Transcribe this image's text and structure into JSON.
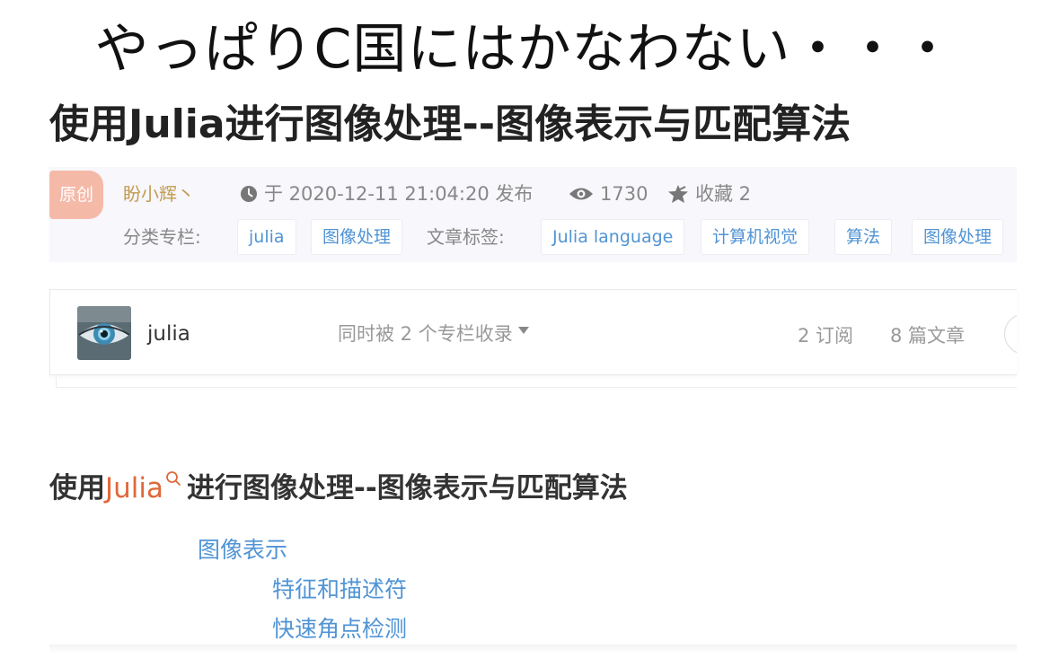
{
  "caption": "やっぱりC国にはかなわない・・・",
  "article": {
    "title": "使用Julia进行图像处理--图像表示与匹配算法",
    "original_badge": "原创",
    "author": "盼小辉丶",
    "published": "于 2020-12-11 21:04:20 发布",
    "views": "1730",
    "favorites": "收藏 2",
    "category_label": "分类专栏:",
    "categories": [
      "julia",
      "图像处理"
    ],
    "tags_label": "文章标签:",
    "tags": [
      "Julia language",
      "计算机视觉",
      "算法",
      "图像处理"
    ]
  },
  "column_card": {
    "name": "julia",
    "collected_text": "同时被 2 个专栏收录",
    "subscriptions": "2 订阅",
    "articles": "8 篇文章"
  },
  "toc": {
    "title_prefix": "使用",
    "title_keyword": "Julia",
    "title_suffix": "进行图像处理--图像表示与匹配算法",
    "items": [
      "图像表示",
      "特征和描述符",
      "快速角点检测"
    ]
  },
  "colors": {
    "badge": "#f5b9a8",
    "author": "#c29b4e",
    "link": "#5094d5",
    "keyword": "#e0683a"
  },
  "icons": [
    "clock-icon",
    "eye-icon",
    "star-icon",
    "caret-down-icon",
    "search-icon"
  ]
}
